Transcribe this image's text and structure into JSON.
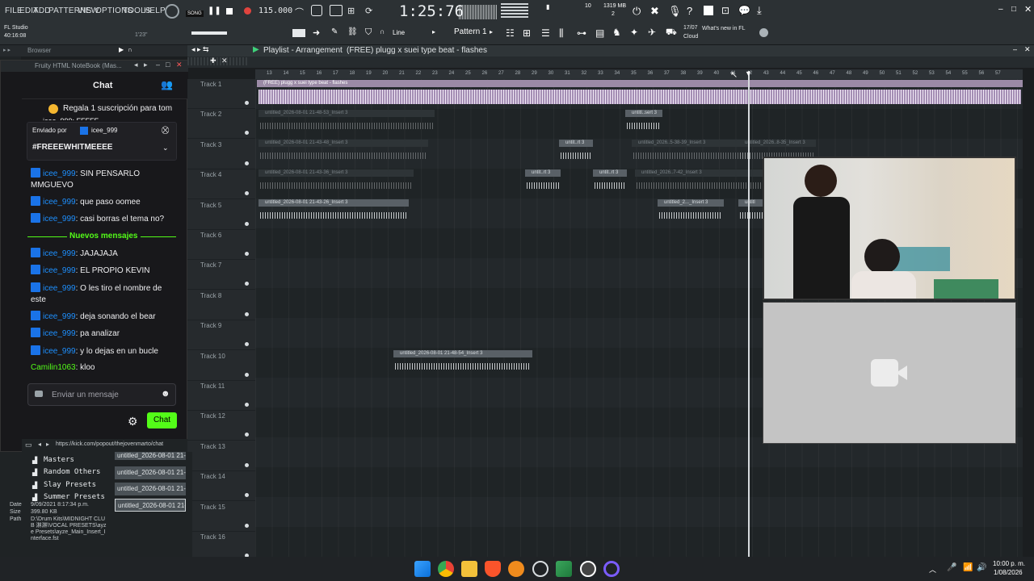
{
  "menu": [
    "FILE",
    "EDIT",
    "ADD",
    "PATTERNS",
    "VIEW",
    "OPTIONS",
    "TOOLS",
    "HELP"
  ],
  "transport": {
    "song_label": "SONG",
    "tempo": "115.000",
    "time": "1:25:76",
    "cpu": "10",
    "mem": "1319 MB",
    "voices": "2"
  },
  "toolbar": {
    "snap": "Line",
    "pattern": "Pattern 1",
    "news_date": "17/07",
    "news_text": "What's new in FL Cloud"
  },
  "app_info": {
    "name": "FL Studio",
    "elapsed": "40:16:08",
    "hint": "1'23\""
  },
  "browser_label": "Browser",
  "chat_window": {
    "title": "Fruity HTML NoteBook (Mas...",
    "heading": "Chat",
    "pinned_sub": "Regala 1 suscripción para tom",
    "pinned_sub2": "icee_999: FFFFF",
    "sent_by_label": "Enviado por",
    "sent_by_user": "icee_999",
    "pinned_msg": "#FREEEWHITMEEEE",
    "new_messages": "Nuevos mensajes",
    "input_placeholder": "Enviar un mensaje",
    "chat_button": "Chat",
    "url": "https://kick.com/popout/thejovenmarto/chat"
  },
  "messages_before": [
    {
      "user": "icee_999",
      "text": ": SIN PENSARLO MMGUEVO"
    },
    {
      "user": "icee_999",
      "text": ": que paso oomee"
    },
    {
      "user": "icee_999",
      "text": ": casi borras el tema no?"
    }
  ],
  "messages_after": [
    {
      "user": "icee_999",
      "text": ": JAJAJAJA"
    },
    {
      "user": "icee_999",
      "text": ": EL PROPIO KEVIN"
    },
    {
      "user": "icee_999",
      "text": ": O les tiro el nombre de este"
    },
    {
      "user": "icee_999",
      "text": ": deja sonando el bear"
    },
    {
      "user": "icee_999",
      "text": ": pa analizar"
    },
    {
      "user": "icee_999",
      "text": ": y lo dejas en un bucle"
    },
    {
      "user": "Camilin1063",
      "text": ": kloo"
    }
  ],
  "playlist": {
    "title": "Playlist - Arrangement",
    "project": "(FREE) plugg x suei type beat - flashes"
  },
  "ruler": [
    "13",
    "14",
    "15",
    "16",
    "17",
    "18",
    "19",
    "20",
    "21",
    "22",
    "23",
    "24",
    "25",
    "26",
    "27",
    "28",
    "29",
    "30",
    "31",
    "32",
    "33",
    "34",
    "35",
    "36",
    "37",
    "38",
    "39",
    "40",
    "41",
    "42",
    "43",
    "44",
    "45",
    "46",
    "47",
    "48",
    "49",
    "50",
    "51",
    "52",
    "53",
    "54",
    "55",
    "56",
    "57"
  ],
  "tracks": [
    "Track 1",
    "Track 2",
    "Track 3",
    "Track 4",
    "Track 5",
    "Track 6",
    "Track 7",
    "Track 8",
    "Track 9",
    "Track 10",
    "Track 11",
    "Track 12",
    "Track 13",
    "Track 14",
    "Track 15",
    "Track 16"
  ],
  "clips": {
    "t1": "(FREE) plugg x suei type beat - flashes",
    "t2a": "untitled_2026-08-01 21-48-53_Insert 3",
    "t2b": "untitl..sert 3",
    "t3a": "untitled_2026-08-01 21-43-48_Insert 3",
    "t3b": "untit..rt 3",
    "t3c": "untitled_2026..5-38-39_Insert 3",
    "t3d": "untitled_2026..8-35_Insert 3",
    "t4a": "untitled_2026-08-01 21-43-36_Insert 3",
    "t4b": "untit..rt 3",
    "t4c": "untit..rt 3",
    "t4d": "untitled_2026..7-42_Insert 3",
    "t5a": "untitled_2026-08-01 21-43-26_Insert 3",
    "t5b": "untitled_2..._Insert 3",
    "t5c": "untitl",
    "t10": "untitled_2026-08-01 21-48-54_Insert 3"
  },
  "filetree": [
    "Masters",
    "Random Others",
    "Slay Presets",
    "Summer Presets"
  ],
  "fileclips": [
    "untitled_2026-08-01 21-",
    "untitled_2026-08-01 21-",
    "untitled_2026-08-01 21-",
    "untitled_2026-08-01 21-"
  ],
  "fileinfo": {
    "date_label": "Date",
    "date": "9/09/2021 8:17:34 p.m.",
    "size_label": "Size",
    "size": "399.80 KB",
    "path_label": "Path",
    "path": "D:\\Drum Kits\\MIDNIGHT CLUB 淋淋\\VOCAL PRESETS\\ayze Presets\\ayze_Main_Insert_Interface.fst"
  },
  "clock": {
    "time": "10:00 p. m.",
    "date": "1/08/2026"
  }
}
